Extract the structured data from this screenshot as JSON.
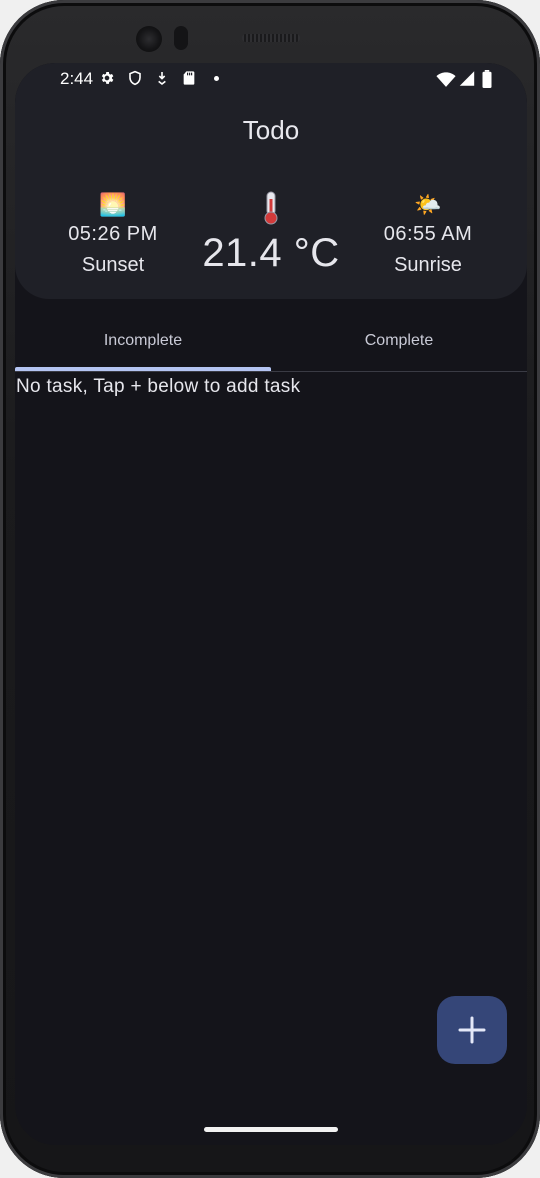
{
  "status_bar": {
    "time": "2:44",
    "left_icons": [
      "gear-icon",
      "shield-icon",
      "download-icon",
      "sd-card-icon",
      "dot-icon"
    ],
    "right_icons": [
      "wifi-icon",
      "signal-icon",
      "battery-icon"
    ]
  },
  "app": {
    "title": "Todo"
  },
  "weather": {
    "sunset": {
      "emoji": "🌅",
      "time": "05:26 PM",
      "label": "Sunset"
    },
    "temperature": {
      "emoji": "🌡️",
      "value": "21.4 °C"
    },
    "sunrise": {
      "emoji": "🌤️",
      "time": "06:55 AM",
      "label": "Sunrise"
    }
  },
  "tabs": [
    {
      "label": "Incomplete",
      "selected": true
    },
    {
      "label": "Complete",
      "selected": false
    }
  ],
  "empty_state": {
    "message": "No task, Tap + below to add task"
  },
  "fab": {
    "icon": "plus-icon"
  },
  "colors": {
    "background": "#14141a",
    "header_card": "#1f2027",
    "tab_indicator": "#b4c4f2",
    "fab": "#354678",
    "text": "#e6e6ec"
  }
}
